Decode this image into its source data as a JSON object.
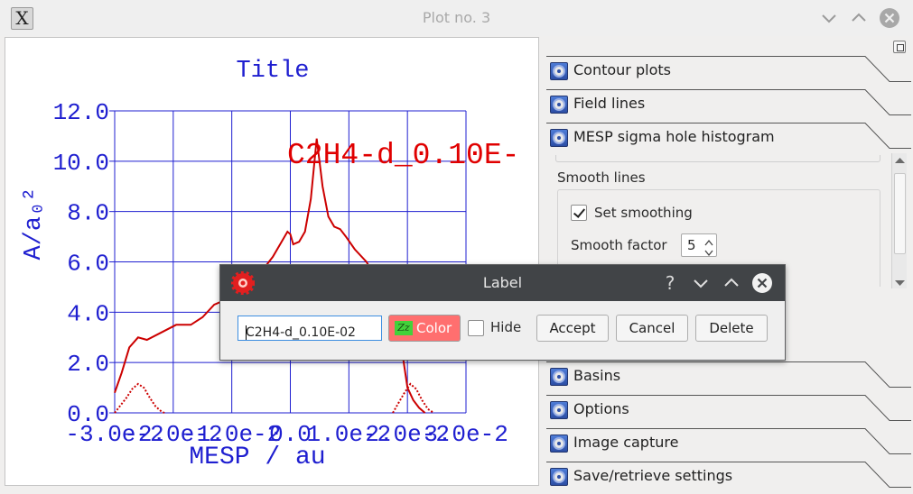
{
  "window": {
    "title": "Plot no. 3",
    "app_icon_text": "X"
  },
  "chart_data": {
    "type": "line",
    "title": "Title",
    "xlabel": "MESP / au",
    "ylabel": "A/a₀²",
    "xlim": [
      -0.03,
      0.03
    ],
    "ylim": [
      0,
      12
    ],
    "x_tick_labels": [
      "-3.0e-2",
      "-2.0e-2",
      "-1.0e-2",
      "0.0",
      "1.0e-2",
      "2.0e-2",
      "3.0e-2"
    ],
    "y_tick_labels": [
      "0.0",
      "2.0",
      "4.0",
      "6.0",
      "8.0",
      "10.0",
      "12.0"
    ],
    "grid": true,
    "annotation": "C2H4-d_0.10E-",
    "series": [
      {
        "style": "solid",
        "color": "#cc0000",
        "x": [
          -0.03,
          -0.0288,
          -0.0275,
          -0.026,
          -0.0245,
          -0.022,
          -0.0195,
          -0.017,
          -0.015,
          -0.013,
          -0.011,
          -0.009,
          -0.007,
          -0.005,
          -0.003,
          -0.0015,
          -0.0005,
          0.0,
          0.0005,
          0.0015,
          0.0025,
          0.0035,
          0.0045,
          0.0055,
          0.0065,
          0.0075,
          0.0085,
          0.0095,
          0.011,
          0.013,
          0.015,
          0.017,
          0.019,
          0.0195,
          0.02,
          0.021,
          0.022,
          0.023
        ],
        "y": [
          0.8,
          1.6,
          2.6,
          3.0,
          2.9,
          3.2,
          3.5,
          3.5,
          3.8,
          4.3,
          4.5,
          4.8,
          5.2,
          5.6,
          6.2,
          6.8,
          7.2,
          7.1,
          6.7,
          6.8,
          7.2,
          8.5,
          10.9,
          9.0,
          7.8,
          7.4,
          7.3,
          7.0,
          6.5,
          6.0,
          5.2,
          4.0,
          2.6,
          1.8,
          1.0,
          0.5,
          0.2,
          0.0
        ]
      },
      {
        "style": "dotted",
        "color": "#cc0000",
        "x": [
          -0.03,
          -0.029,
          -0.028,
          -0.027,
          -0.026,
          -0.025,
          -0.024,
          -0.023,
          -0.022,
          -0.0215,
          0.0175,
          0.0185,
          0.0195,
          0.0205,
          0.0215,
          0.0225,
          0.0235,
          0.0245
        ],
        "y": [
          0.0,
          0.3,
          0.6,
          0.95,
          1.15,
          1.0,
          0.6,
          0.25,
          0.05,
          0.0,
          0.0,
          0.4,
          0.8,
          1.15,
          0.95,
          0.5,
          0.15,
          0.0
        ]
      }
    ]
  },
  "sections": [
    {
      "label": "Contour plots"
    },
    {
      "label": "Field lines"
    },
    {
      "label": "MESP sigma hole histogram"
    }
  ],
  "sections_bottom": [
    {
      "label": "Basins"
    },
    {
      "label": "Options"
    },
    {
      "label": "Image capture"
    },
    {
      "label": "Save/retrieve settings"
    }
  ],
  "smooth": {
    "group_label": "Smooth lines",
    "checkbox_label": "Set smoothing",
    "checkbox_checked": true,
    "factor_label": "Smooth factor",
    "factor_value": "5"
  },
  "dialog": {
    "title": "Label",
    "help": "?",
    "input_value": "C2H4-d_0.10E-02",
    "color_label": "Color",
    "color_swatch_text": "Zz",
    "color_value": "#ff6f6f",
    "hide_label": "Hide",
    "hide_checked": false,
    "accept_label": "Accept",
    "cancel_label": "Cancel",
    "delete_label": "Delete"
  }
}
